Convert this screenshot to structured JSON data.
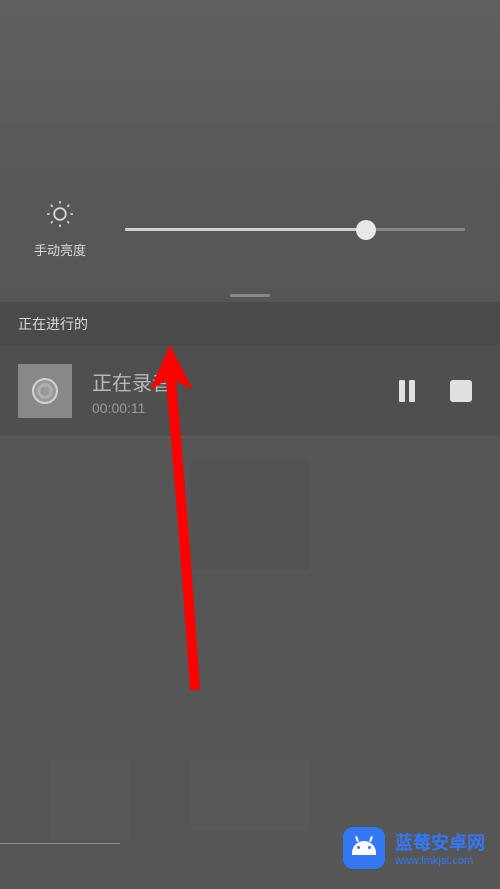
{
  "brightness": {
    "label": "手动亮度",
    "value": 71
  },
  "section_header": "正在进行的",
  "notification": {
    "title": "正在录音",
    "time": "00:00:11"
  },
  "watermark": {
    "title": "蓝莓安卓网",
    "url": "www.lmkjst.com"
  },
  "annotation": {
    "arrow_target": "recording-notification",
    "arrow_color": "#ff0000"
  }
}
